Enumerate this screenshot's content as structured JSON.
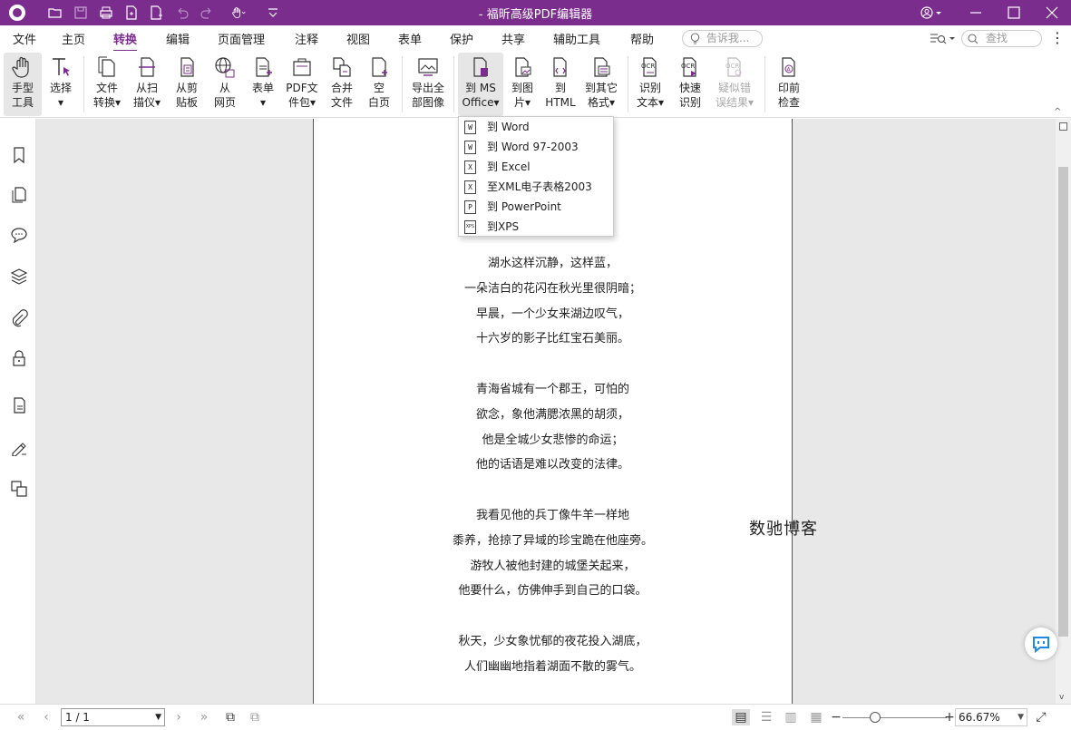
{
  "titlebar": {
    "title": "- 福昕高级PDF编辑器",
    "quick_access": [
      "open-icon",
      "save-icon",
      "print-icon",
      "new-icon",
      "new-blank-icon",
      "undo-icon",
      "redo-icon",
      "hand-icon",
      "customize-icon"
    ]
  },
  "menu": {
    "tabs": [
      "文件",
      "主页",
      "转换",
      "编辑",
      "页面管理",
      "注释",
      "视图",
      "表单",
      "保护",
      "共享",
      "辅助工具",
      "帮助"
    ],
    "active": "转换",
    "tell_placeholder": "告诉我...",
    "search_placeholder": "查找"
  },
  "ribbon": {
    "hand_tool": [
      "手型",
      "工具"
    ],
    "select": [
      "选择",
      "▾"
    ],
    "file_convert": [
      "文件",
      "转换▾"
    ],
    "from_scanner": [
      "从扫",
      "描仪▾"
    ],
    "from_clipboard": [
      "从剪",
      "贴板"
    ],
    "from_web": [
      "从",
      "网页"
    ],
    "form": [
      "表单",
      "▾"
    ],
    "pdf_portfolio": [
      "PDF文",
      "件包▾"
    ],
    "merge_files": [
      "合并",
      "文件"
    ],
    "blank_page": [
      "空",
      "白页"
    ],
    "export_images": [
      "导出全",
      "部图像"
    ],
    "to_ms_office": [
      "到 MS",
      "Office▾"
    ],
    "to_image": [
      "到图",
      "片▾"
    ],
    "to_html": [
      "到",
      "HTML"
    ],
    "to_other": [
      "到其它",
      "格式▾"
    ],
    "ocr_text": [
      "识别",
      "文本▾"
    ],
    "quick_ocr": [
      "快速",
      "识别"
    ],
    "suspect_results": [
      "疑似错",
      "误结果▾"
    ],
    "preflight": [
      "印前",
      "检查"
    ]
  },
  "dropdown": {
    "items": [
      {
        "label": "到 Word",
        "icon": "W"
      },
      {
        "label": "到 Word 97-2003",
        "icon": "W"
      },
      {
        "label": "到 Excel",
        "icon": "X"
      },
      {
        "label": "至XML电子表格2003",
        "icon": "X"
      },
      {
        "label": "到 PowerPoint",
        "icon": "P"
      },
      {
        "label": "到XPS",
        "icon": "XPS"
      }
    ]
  },
  "document": {
    "stanzas": [
      [
        "湖水这样沉静，这样蓝，",
        "一朵洁白的花闪在秋光里很阴暗；",
        "早晨，一个少女来湖边叹气，",
        "十六岁的影子比红宝石美丽。"
      ],
      [
        "青海省城有一个郡王，可怕的",
        "欲念，象他满腮浓黑的胡须，",
        "他是全城少女悲惨的命运；",
        "他的话语是难以改变的法律。"
      ],
      [
        "我看见他的兵丁像牛羊一样地",
        "黍养，抢掠了异域的珍宝跪在他座旁。",
        "游牧人被他封建的城堡关起来，",
        "他要什么，仿佛伸手到自己的口袋。"
      ],
      [
        "秋天，少女象忧郁的夜花投入湖底，",
        "人们幽幽地指着湖面不散的雾气。"
      ]
    ],
    "watermark": "数驰博客"
  },
  "statusbar": {
    "page": "1 / 1",
    "zoom": "66.67%"
  },
  "colors": {
    "brand": "#7b2d8e",
    "doc_background": "#e8e8e8"
  }
}
